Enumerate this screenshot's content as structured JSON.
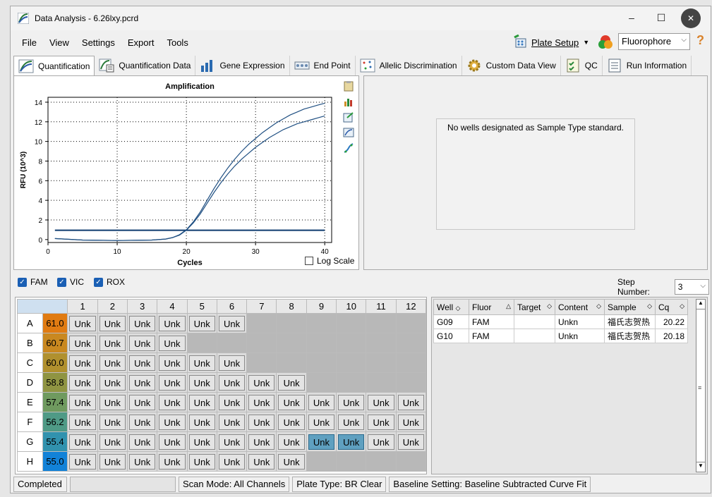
{
  "window": {
    "title": "Data Analysis - 6.26lxy.pcrd",
    "minimize": "–",
    "maximize": "☐",
    "close": "✕"
  },
  "menu": {
    "items": [
      "File",
      "View",
      "Settings",
      "Export",
      "Tools"
    ]
  },
  "toolbar": {
    "plate_setup": "Plate Setup",
    "fluorophore": "Fluorophore",
    "help": "?"
  },
  "tabs": [
    {
      "label": "Quantification"
    },
    {
      "label": "Quantification Data"
    },
    {
      "label": "Gene Expression"
    },
    {
      "label": "End Point"
    },
    {
      "label": "Allelic Discrimination"
    },
    {
      "label": "Custom Data View"
    },
    {
      "label": "QC"
    },
    {
      "label": "Run Information"
    }
  ],
  "right_pane": {
    "message": "No wells designated as Sample Type standard."
  },
  "log_scale_label": "Log Scale",
  "fluor_checks": [
    {
      "label": "FAM",
      "checked": true
    },
    {
      "label": "VIC",
      "checked": true
    },
    {
      "label": "ROX",
      "checked": true
    }
  ],
  "step": {
    "label": "Step Number:",
    "value": "3"
  },
  "plate": {
    "columns": [
      "1",
      "2",
      "3",
      "4",
      "5",
      "6",
      "7",
      "8",
      "9",
      "10",
      "11",
      "12"
    ],
    "rows": [
      {
        "label": "A",
        "temp": "61.0",
        "color": "#e07b12",
        "filled": 6,
        "selected": []
      },
      {
        "label": "B",
        "temp": "60.7",
        "color": "#c98820",
        "filled": 4,
        "selected": []
      },
      {
        "label": "C",
        "temp": "60.0",
        "color": "#b0902e",
        "filled": 6,
        "selected": []
      },
      {
        "label": "D",
        "temp": "58.8",
        "color": "#8f9442",
        "filled": 8,
        "selected": []
      },
      {
        "label": "E",
        "temp": "57.4",
        "color": "#6f9a5f",
        "filled": 12,
        "selected": []
      },
      {
        "label": "F",
        "temp": "56.2",
        "color": "#4f9a86",
        "filled": 12,
        "selected": []
      },
      {
        "label": "G",
        "temp": "55.4",
        "color": "#3192ae",
        "filled": 12,
        "selected": [
          8,
          9
        ]
      },
      {
        "label": "H",
        "temp": "55.0",
        "color": "#1282d8",
        "filled": 8,
        "selected": []
      }
    ],
    "well_label": "Unk"
  },
  "results": {
    "headers": [
      "Well",
      "Fluor",
      "Target",
      "Content",
      "Sample",
      "Cq"
    ],
    "rows": [
      [
        "G09",
        "FAM",
        "",
        "Unkn",
        "福氏志贺热",
        "20.22"
      ],
      [
        "G10",
        "FAM",
        "",
        "Unkn",
        "福氏志贺热",
        "20.18"
      ]
    ]
  },
  "status": {
    "state": "Completed",
    "scan_mode": "Scan Mode: All Channels",
    "plate_type": "Plate Type: BR Clear",
    "baseline": "Baseline Setting: Baseline Subtracted Curve Fit"
  },
  "colors": {
    "curve": "#1f4f82",
    "threshold": "#0d3a6e",
    "accent": "#1a5fb4"
  },
  "chart_data": {
    "type": "line",
    "title": "Amplification",
    "xlabel": "Cycles",
    "ylabel": "RFU (10^3)",
    "xlim": [
      0,
      41
    ],
    "ylim": [
      -0.3,
      14.5
    ],
    "xticks": [
      0,
      10,
      20,
      30,
      40
    ],
    "yticks": [
      0,
      2,
      4,
      6,
      8,
      10,
      12,
      14
    ],
    "grid": true,
    "threshold": 0.95,
    "series": [
      {
        "x": [
          1,
          5,
          10,
          15,
          17,
          18,
          19,
          20,
          21,
          22,
          23,
          24,
          25,
          26,
          27,
          28,
          29,
          30,
          31,
          32,
          33,
          34,
          35,
          36,
          37,
          38,
          39,
          40
        ],
        "values": [
          0.1,
          -0.05,
          -0.1,
          -0.05,
          0.05,
          0.2,
          0.5,
          1.0,
          1.8,
          2.8,
          4.0,
          5.2,
          6.3,
          7.3,
          8.2,
          9.0,
          9.7,
          10.3,
          10.9,
          11.4,
          11.9,
          12.3,
          12.7,
          13.0,
          13.3,
          13.5,
          13.7,
          13.9
        ]
      },
      {
        "x": [
          1,
          5,
          10,
          15,
          17,
          18,
          19,
          20,
          21,
          22,
          23,
          24,
          25,
          26,
          27,
          28,
          29,
          30,
          31,
          32,
          33,
          34,
          35,
          36,
          37,
          38,
          39,
          40
        ],
        "values": [
          0.1,
          -0.05,
          -0.1,
          -0.05,
          0.05,
          0.2,
          0.45,
          0.95,
          1.7,
          2.6,
          3.7,
          4.8,
          5.8,
          6.7,
          7.5,
          8.2,
          8.8,
          9.4,
          9.9,
          10.4,
          10.8,
          11.2,
          11.5,
          11.8,
          12.0,
          12.2,
          12.4,
          12.6
        ]
      }
    ]
  }
}
